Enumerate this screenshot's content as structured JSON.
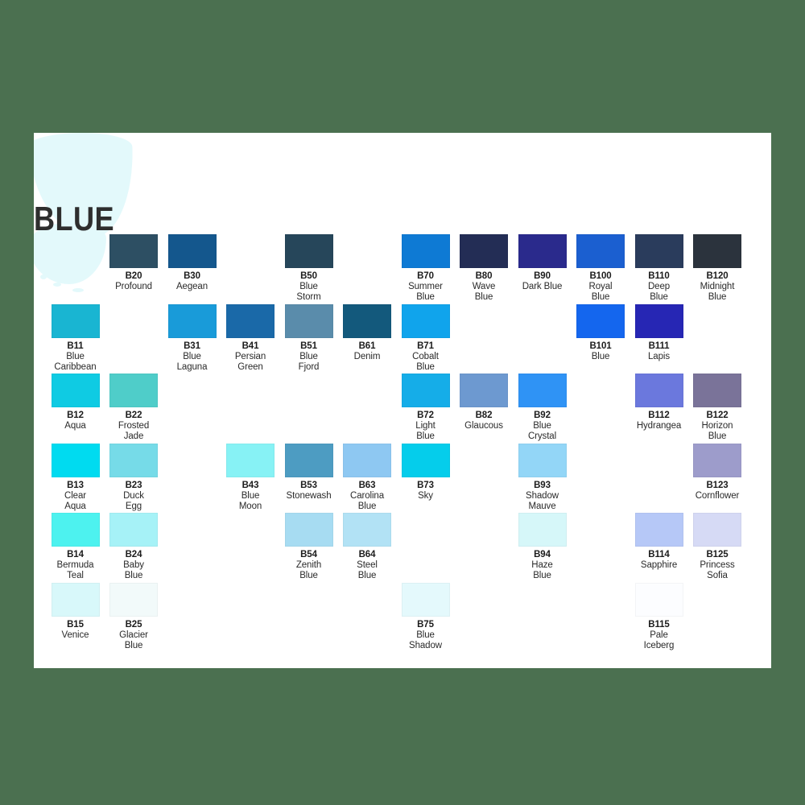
{
  "background_color": "#4b7050",
  "page": {
    "background_color": "#ffffff",
    "title": "BLUE",
    "brush_color": "#e3f9fb"
  },
  "grid": {
    "columns": 12,
    "column_spacing": 72.5,
    "row_spacing": 86.6,
    "chip_width": 60,
    "chip_height": 42
  },
  "swatches": [
    {
      "code": "B20",
      "name": "Profound",
      "color": "#2d4f63",
      "col": 2,
      "row": 0
    },
    {
      "code": "B30",
      "name": "Aegean",
      "color": "#14578d",
      "col": 3,
      "row": 0
    },
    {
      "code": "B50",
      "name": "Blue\nStorm",
      "color": "#26465a",
      "col": 5,
      "row": 0
    },
    {
      "code": "B70",
      "name": "Summer\nBlue",
      "color": "#0e7ad4",
      "col": 7,
      "row": 0
    },
    {
      "code": "B80",
      "name": "Wave\nBlue",
      "color": "#232d55",
      "col": 8,
      "row": 0
    },
    {
      "code": "B90",
      "name": "Dark Blue",
      "color": "#2a2a8c",
      "col": 9,
      "row": 0
    },
    {
      "code": "B100",
      "name": "Royal\nBlue",
      "color": "#1b5fd0",
      "col": 10,
      "row": 0
    },
    {
      "code": "B110",
      "name": "Deep\nBlue",
      "color": "#2a3c5c",
      "col": 11,
      "row": 0
    },
    {
      "code": "B120",
      "name": "Midnight\nBlue",
      "color": "#2b333d",
      "col": 12,
      "row": 0
    },
    {
      "code": "B11",
      "name": "Blue\nCaribbean",
      "color": "#19b5d2",
      "col": 1,
      "row": 1
    },
    {
      "code": "B31",
      "name": "Blue\nLaguna",
      "color": "#199bd9",
      "col": 3,
      "row": 1
    },
    {
      "code": "B41",
      "name": "Persian\nGreen",
      "color": "#1a69a8",
      "col": 4,
      "row": 1
    },
    {
      "code": "B51",
      "name": "Blue\nFjord",
      "color": "#5a8cab",
      "col": 5,
      "row": 1
    },
    {
      "code": "B61",
      "name": "Denim",
      "color": "#13597c",
      "col": 6,
      "row": 1
    },
    {
      "code": "B71",
      "name": "Cobalt\nBlue",
      "color": "#10a4ec",
      "col": 7,
      "row": 1
    },
    {
      "code": "B101",
      "name": "Blue",
      "color": "#1466ee",
      "col": 10,
      "row": 1
    },
    {
      "code": "B111",
      "name": "Lapis",
      "color": "#2626b4",
      "col": 11,
      "row": 1
    },
    {
      "code": "B12",
      "name": "Aqua",
      "color": "#0fcbe3",
      "col": 1,
      "row": 2
    },
    {
      "code": "B22",
      "name": "Frosted\nJade",
      "color": "#4fcdc9",
      "col": 2,
      "row": 2
    },
    {
      "code": "B72",
      "name": "Light\nBlue",
      "color": "#15ade8",
      "col": 7,
      "row": 2
    },
    {
      "code": "B82",
      "name": "Glaucous",
      "color": "#6d99d0",
      "col": 8,
      "row": 2
    },
    {
      "code": "B92",
      "name": "Blue\nCrystal",
      "color": "#2f93f5",
      "col": 9,
      "row": 2
    },
    {
      "code": "B112",
      "name": "Hydrangea",
      "color": "#6b78dd",
      "col": 11,
      "row": 2
    },
    {
      "code": "B122",
      "name": "Horizon\nBlue",
      "color": "#7a7399",
      "col": 12,
      "row": 2
    },
    {
      "code": "B13",
      "name": "Clear\nAqua",
      "color": "#00dbf0",
      "col": 1,
      "row": 3
    },
    {
      "code": "B23",
      "name": "Duck\nEgg",
      "color": "#76dbe8",
      "col": 2,
      "row": 3
    },
    {
      "code": "B43",
      "name": "Blue\nMoon",
      "color": "#87f2f5",
      "col": 4,
      "row": 3
    },
    {
      "code": "B53",
      "name": "Stonewash",
      "color": "#4d9cc2",
      "col": 5,
      "row": 3
    },
    {
      "code": "B63",
      "name": "Carolina\nBlue",
      "color": "#8ec8f2",
      "col": 6,
      "row": 3
    },
    {
      "code": "B73",
      "name": "Sky",
      "color": "#05cdeb",
      "col": 7,
      "row": 3
    },
    {
      "code": "B93",
      "name": "Shadow\nMauve",
      "color": "#93d6f7",
      "col": 9,
      "row": 3
    },
    {
      "code": "B123",
      "name": "Cornflower",
      "color": "#9d9ccb",
      "col": 12,
      "row": 3
    },
    {
      "code": "B14",
      "name": "Bermuda\nTeal",
      "color": "#4df2ef",
      "col": 1,
      "row": 4
    },
    {
      "code": "B24",
      "name": "Baby\nBlue",
      "color": "#a6f2f7",
      "col": 2,
      "row": 4
    },
    {
      "code": "B54",
      "name": "Zenith\nBlue",
      "color": "#a7dcf2",
      "col": 5,
      "row": 4
    },
    {
      "code": "B64",
      "name": "Steel\nBlue",
      "color": "#b2e2f5",
      "col": 6,
      "row": 4
    },
    {
      "code": "B94",
      "name": "Haze\nBlue",
      "color": "#d6f7f9",
      "col": 9,
      "row": 4
    },
    {
      "code": "B114",
      "name": "Sapphire",
      "color": "#b6c8f7",
      "col": 11,
      "row": 4
    },
    {
      "code": "B125",
      "name": "Princess\nSofia",
      "color": "#d6daf5",
      "col": 12,
      "row": 4
    },
    {
      "code": "B15",
      "name": "Venice",
      "color": "#d8f8fa",
      "col": 1,
      "row": 5
    },
    {
      "code": "B25",
      "name": "Glacier\nBlue",
      "color": "#f2fafa",
      "col": 2,
      "row": 5
    },
    {
      "code": "B75",
      "name": "Blue\nShadow",
      "color": "#e4f9fc",
      "col": 7,
      "row": 5
    },
    {
      "code": "B115",
      "name": "Pale\nIceberg",
      "color": "#fcfdff",
      "col": 11,
      "row": 5
    }
  ]
}
